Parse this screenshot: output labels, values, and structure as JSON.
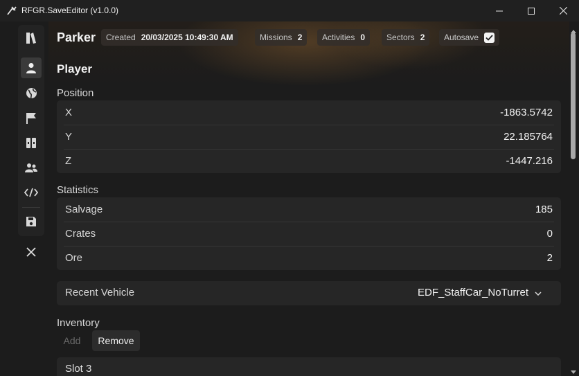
{
  "window": {
    "title": "RFGR.SaveEditor (v1.0.0)"
  },
  "sidebar": {
    "items": [
      {
        "icon": "book-icon",
        "name": "sidebar-item-saves"
      },
      {
        "icon": "person-icon",
        "name": "sidebar-item-player",
        "active": true
      },
      {
        "icon": "globe-icon",
        "name": "sidebar-item-world"
      },
      {
        "icon": "flag-icon",
        "name": "sidebar-item-missions"
      },
      {
        "icon": "columns-icon",
        "name": "sidebar-item-activities"
      },
      {
        "icon": "users-icon",
        "name": "sidebar-item-people"
      },
      {
        "icon": "code-icon",
        "name": "sidebar-item-raw"
      },
      {
        "icon": "floppy-icon",
        "name": "sidebar-item-save"
      }
    ],
    "exit_icon": "close-icon"
  },
  "header": {
    "save_name": "Parker",
    "created_label": "Created",
    "created_value": "20/03/2025 10:49:30 AM",
    "missions_label": "Missions",
    "missions_value": "2",
    "activities_label": "Activities",
    "activities_value": "0",
    "sectors_label": "Sectors",
    "sectors_value": "2",
    "autosave_label": "Autosave",
    "autosave_checked": true
  },
  "page": {
    "title": "Player"
  },
  "position": {
    "title": "Position",
    "rows": [
      {
        "label": "X",
        "value": "-1863.5742"
      },
      {
        "label": "Y",
        "value": "22.185764"
      },
      {
        "label": "Z",
        "value": "-1447.216"
      }
    ]
  },
  "statistics": {
    "title": "Statistics",
    "rows": [
      {
        "label": "Salvage",
        "value": "185"
      },
      {
        "label": "Crates",
        "value": "0"
      },
      {
        "label": "Ore",
        "value": "2"
      }
    ]
  },
  "vehicle": {
    "label": "Recent Vehicle",
    "selected": "EDF_StaffCar_NoTurret"
  },
  "inventory": {
    "title": "Inventory",
    "add_label": "Add",
    "remove_label": "Remove",
    "slot_title": "Slot 3"
  },
  "colors": {
    "background": "#1c1c1c",
    "card": "#262626",
    "text": "#e8e8e8"
  }
}
